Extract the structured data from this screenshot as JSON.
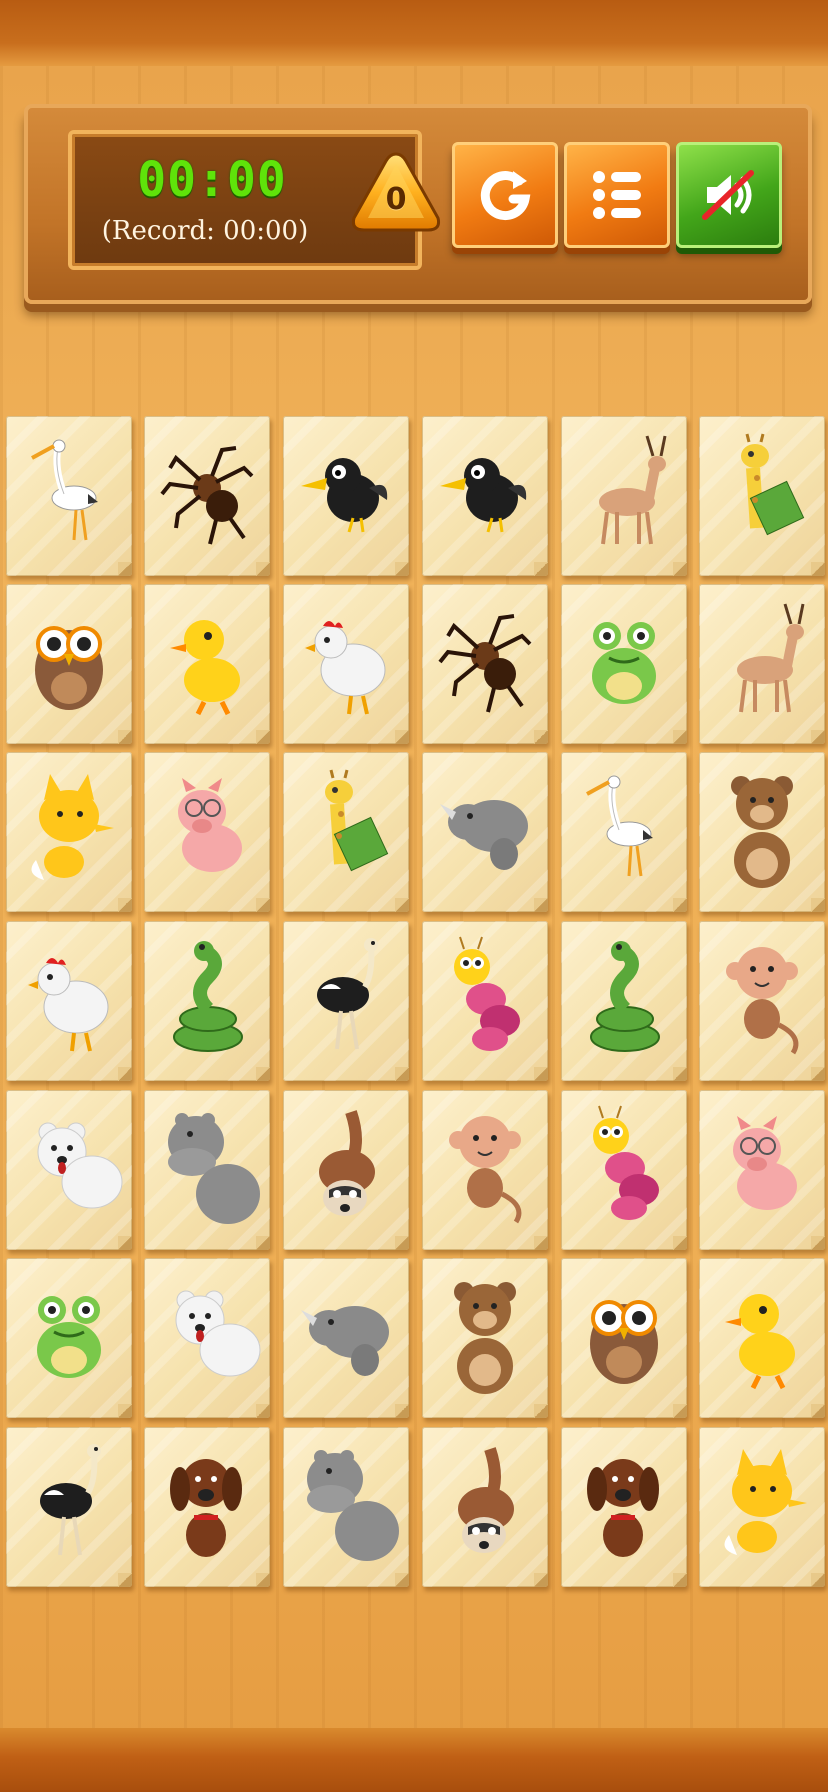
{
  "hud": {
    "timer": "00:00",
    "record": "(Record: 00:00)",
    "gem_count": "0"
  },
  "buttons": [
    {
      "name": "restart-button",
      "icon": "restart-icon",
      "color": "#f17b12"
    },
    {
      "name": "menu-button",
      "icon": "menu-list-icon",
      "color": "#f17b12"
    },
    {
      "name": "sound-toggle-button",
      "icon": "sound-muted-icon",
      "color": "#43a61a"
    }
  ],
  "board": {
    "rows": 7,
    "cols": 6,
    "tiles": [
      [
        "crane",
        "spider",
        "crow",
        "crow",
        "deer",
        "giraffe"
      ],
      [
        "owl",
        "duck",
        "chicken",
        "spider",
        "frog",
        "deer"
      ],
      [
        "fox",
        "pig",
        "giraffe",
        "rhino",
        "crane",
        "bear"
      ],
      [
        "chicken",
        "snake",
        "ostrich",
        "caterpillar",
        "snake",
        "monkey"
      ],
      [
        "polar-bear",
        "hippo",
        "raccoon",
        "monkey",
        "caterpillar",
        "pig"
      ],
      [
        "frog",
        "polar-bear",
        "rhino",
        "bear",
        "owl",
        "duck"
      ],
      [
        "ostrich",
        "dog",
        "hippo",
        "raccoon",
        "dog",
        "fox"
      ]
    ]
  }
}
